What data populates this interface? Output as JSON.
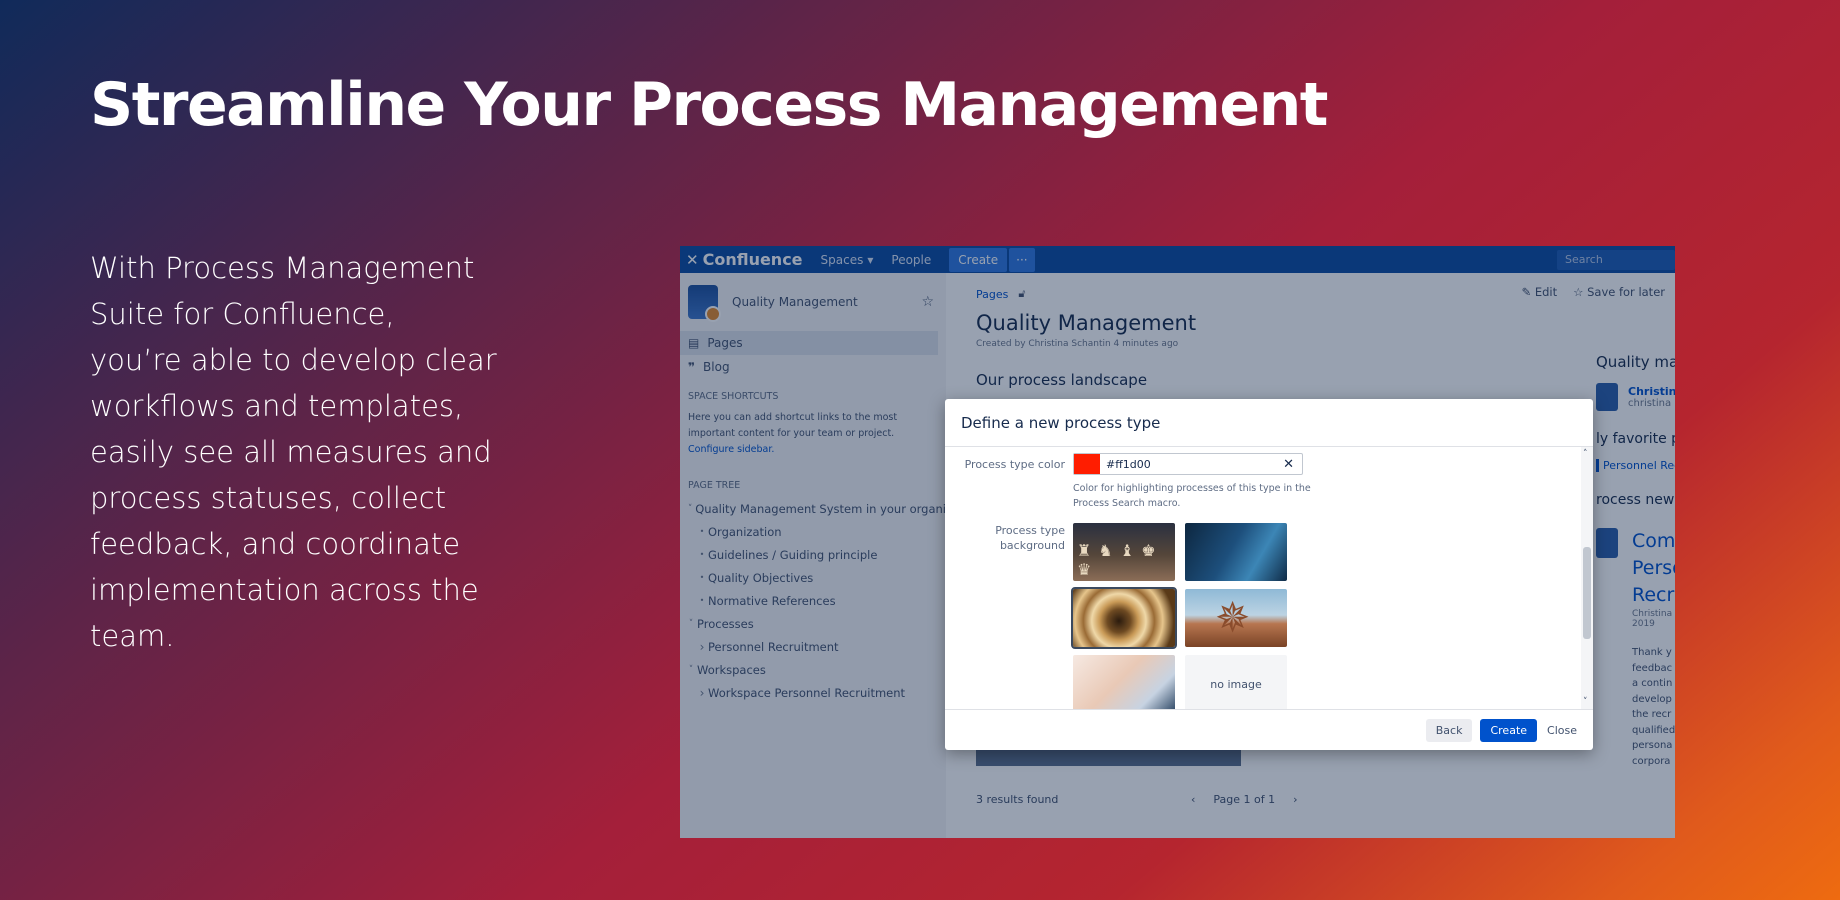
{
  "hero": {
    "title": "Streamline Your Process Management",
    "lines": [
      "With Process Management",
      "Suite for Confluence,",
      "you’re able to develop clear",
      "workflows and templates,",
      "easily see all measures and",
      "process statuses, collect",
      "feedback, and coordinate",
      "implementation across the",
      "team."
    ]
  },
  "topbar": {
    "logo": "Confluence",
    "spaces": "Spaces",
    "people": "People",
    "create": "Create",
    "more": "···",
    "search_placeholder": "Search"
  },
  "sidebar": {
    "space_name": "Quality Management",
    "pages": "Pages",
    "blog": "Blog",
    "shortcuts_heading": "SPACE SHORTCUTS",
    "shortcuts_text": "Here you can add shortcut links to the most important content for your team or project.",
    "configure_link": "Configure sidebar.",
    "tree_heading": "PAGE TREE",
    "tree": [
      {
        "label": "Quality Management System in your organi",
        "level": 0,
        "toggle": "˅"
      },
      {
        "label": "Organization",
        "level": 1,
        "toggle": "•"
      },
      {
        "label": "Guidelines / Guiding principle",
        "level": 1,
        "toggle": "•"
      },
      {
        "label": "Quality Objectives",
        "level": 1,
        "toggle": "•"
      },
      {
        "label": "Normative References",
        "level": 1,
        "toggle": "•"
      },
      {
        "label": "Processes",
        "level": 0,
        "toggle": "˅"
      },
      {
        "label": "Personnel Recruitment",
        "level": 1,
        "toggle": "›"
      },
      {
        "label": "Workspaces",
        "level": 0,
        "toggle": "˅"
      },
      {
        "label": "Workspace Personnel Recruitment",
        "level": 1,
        "toggle": "›"
      }
    ]
  },
  "main": {
    "breadcrumb": "Pages",
    "edit": "Edit",
    "save_for_later": "Save for later",
    "title": "Quality Management",
    "byline": "Created by Christina Schantin 4 minutes ago",
    "section": "Our process landscape",
    "results": "3 results found",
    "page_info": "Page 1 of 1"
  },
  "right_col": {
    "title": "Quality manag",
    "user_name": "Christina",
    "user_email": "christina",
    "fav": "ly favorite pr",
    "fav_link": "Personnel Recr",
    "news": "rocess news",
    "post_lines": [
      "Comp",
      "Perso",
      "Recru"
    ],
    "post_meta": [
      "Christina S",
      "2019"
    ],
    "post_body": [
      "Thank y",
      "feedbac",
      "a contin",
      "develop",
      "the recr",
      "qualified",
      "persona",
      "corpora"
    ]
  },
  "dialog": {
    "title": "Define a new process type",
    "color_label": "Process type color",
    "color_value": "#ff1d00",
    "help": "Color for highlighting processes of this type in the Process Search macro.",
    "bg_label": "Process type background",
    "no_image": "no image",
    "back": "Back",
    "create": "Create",
    "close": "Close"
  },
  "colors": {
    "confluence_blue": "#0c4aa0",
    "primary_button": "#0052cc",
    "swatch": "#ff1d00"
  }
}
